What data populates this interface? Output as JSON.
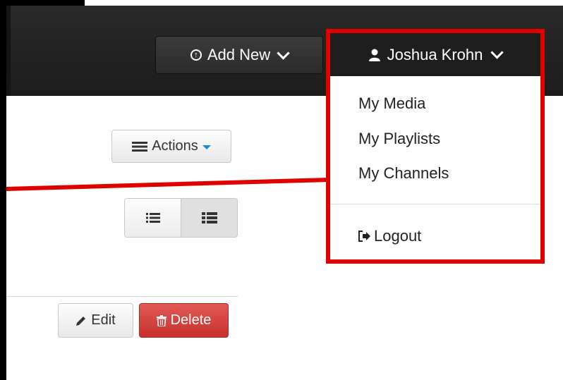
{
  "header": {
    "add_new_label": "Add New",
    "user_name": "Joshua Krohn"
  },
  "user_menu": {
    "items": [
      {
        "label": "My Media"
      },
      {
        "label": "My Playlists"
      },
      {
        "label": "My Channels"
      }
    ],
    "logout_label": "Logout"
  },
  "toolbar": {
    "actions_label": "Actions"
  },
  "row_actions": {
    "edit_label": "Edit",
    "delete_label": "Delete"
  },
  "colors": {
    "topbar": "#1e1e1e",
    "highlight": "#e00000",
    "delete": "#c9302c",
    "caret": "#1a8ad3"
  },
  "icons": [
    "circle-arrow-up-icon",
    "user-icon",
    "chevron-down-icon",
    "list-icon",
    "pencil-icon",
    "trash-icon",
    "logout-icon"
  ]
}
